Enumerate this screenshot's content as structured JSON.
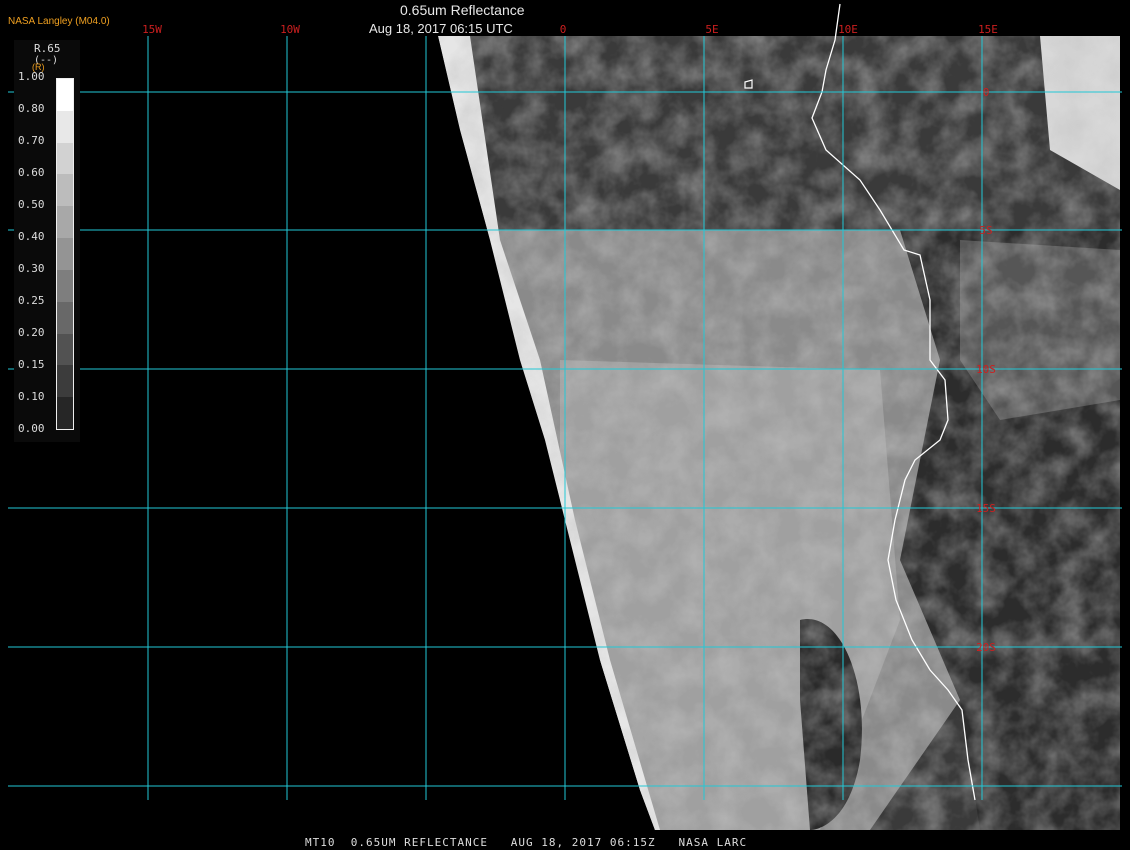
{
  "header": {
    "organization": "NASA Langley (M04.0)",
    "title": "0.65um Reflectance",
    "datetime": "Aug 18, 2017 06:15 UTC"
  },
  "legend": {
    "name": "R.65",
    "unit": "(--)",
    "letter": "(R)",
    "ticks": [
      "1.00",
      "0.80",
      "0.70",
      "0.60",
      "0.50",
      "0.40",
      "0.30",
      "0.25",
      "0.20",
      "0.15",
      "0.10",
      "0.00"
    ],
    "grays": [
      "#ffffff",
      "#e8e8e8",
      "#d2d2d2",
      "#bcbcbc",
      "#a8a8a8",
      "#949494",
      "#7e7e7e",
      "#686868",
      "#525252",
      "#3c3c3c",
      "#262626"
    ]
  },
  "longitude_labels": [
    "15W",
    "10W",
    "0",
    "5E",
    "10E",
    "15E"
  ],
  "latitude_labels": [
    "0",
    "5S",
    "10S",
    "15S",
    "20S"
  ],
  "footer": "MT10  0.65UM REFLECTANCE   AUG 18, 2017 06:15Z   NASA LARC",
  "colors": {
    "grid": "#22c8d6",
    "label_red": "#cc1f1f",
    "coastline": "#ffffff",
    "background": "#000000"
  }
}
